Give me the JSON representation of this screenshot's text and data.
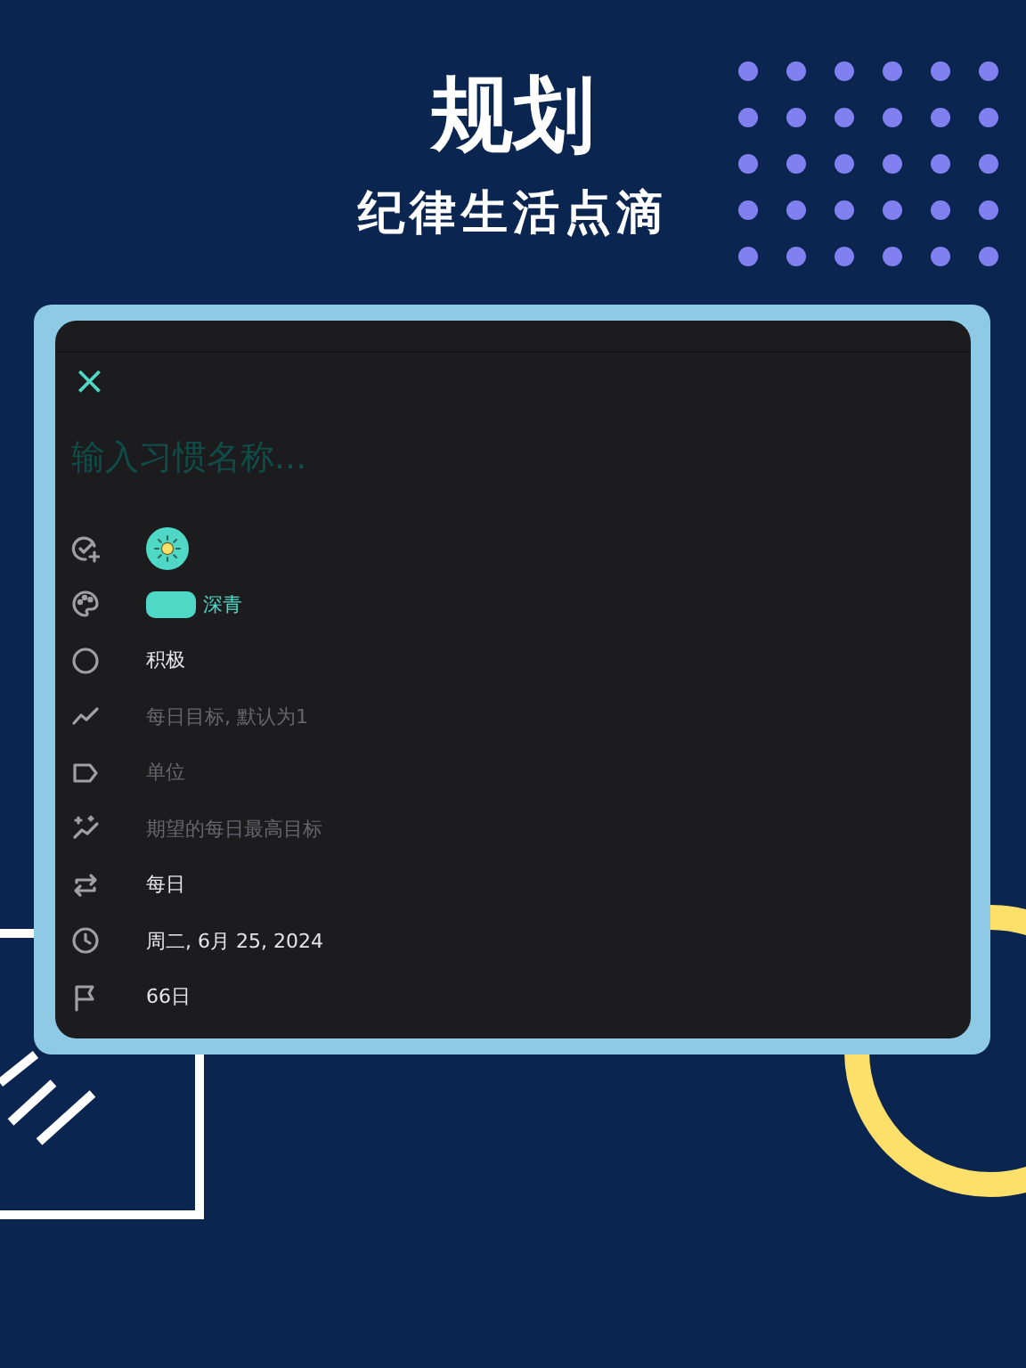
{
  "headline": "规划",
  "subtitle": "纪律生活点滴",
  "form": {
    "close": "×",
    "name_placeholder": "输入习惯名称...",
    "rows": [
      {
        "kind": "icon"
      },
      {
        "kind": "color",
        "color": "#4fd8c6",
        "label": "深青"
      },
      {
        "kind": "value",
        "value": "积极"
      },
      {
        "kind": "field",
        "placeholder": "每日目标, 默认为1"
      },
      {
        "kind": "field",
        "placeholder": "单位"
      },
      {
        "kind": "field",
        "placeholder": "期望的每日最高目标"
      },
      {
        "kind": "value",
        "value": "每日"
      },
      {
        "kind": "value",
        "value": "周二, 6月 25, 2024"
      },
      {
        "kind": "value",
        "value": "66日"
      }
    ]
  }
}
